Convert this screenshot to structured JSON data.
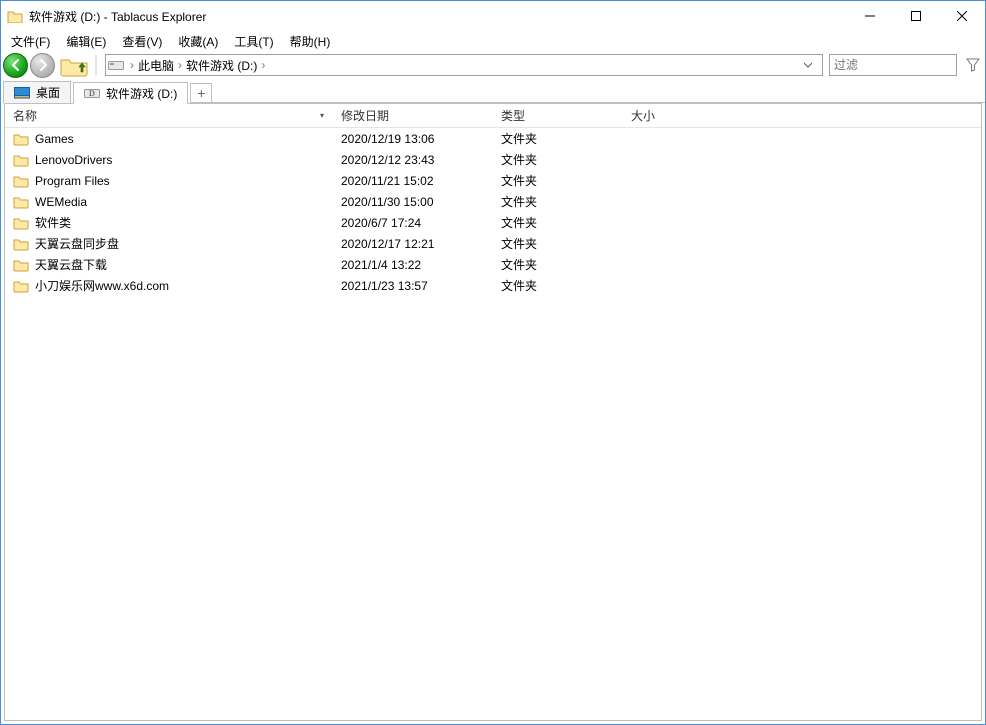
{
  "window_title": "软件游戏 (D:) - Tablacus Explorer",
  "menu": [
    "文件(F)",
    "编辑(E)",
    "查看(V)",
    "收藏(A)",
    "工具(T)",
    "帮助(H)"
  ],
  "breadcrumbs": [
    "此电脑",
    "软件游戏 (D:)"
  ],
  "filter_placeholder": "过滤",
  "tabs": [
    {
      "label": "桌面",
      "icon": "desktop",
      "active": false
    },
    {
      "label": "软件游戏 (D:)",
      "icon": "drive",
      "active": true
    }
  ],
  "columns": {
    "name": "名称",
    "date": "修改日期",
    "type": "类型",
    "size": "大小"
  },
  "rows": [
    {
      "name": "Games",
      "date": "2020/12/19 13:06",
      "type": "文件夹",
      "size": ""
    },
    {
      "name": "LenovoDrivers",
      "date": "2020/12/12 23:43",
      "type": "文件夹",
      "size": ""
    },
    {
      "name": "Program Files",
      "date": "2020/11/21 15:02",
      "type": "文件夹",
      "size": ""
    },
    {
      "name": "WEMedia",
      "date": "2020/11/30 15:00",
      "type": "文件夹",
      "size": ""
    },
    {
      "name": "软件类",
      "date": "2020/6/7 17:24",
      "type": "文件夹",
      "size": ""
    },
    {
      "name": "天翼云盘同步盘",
      "date": "2020/12/17 12:21",
      "type": "文件夹",
      "size": ""
    },
    {
      "name": "天翼云盘下载",
      "date": "2021/1/4 13:22",
      "type": "文件夹",
      "size": ""
    },
    {
      "name": "小刀娱乐网www.x6d.com",
      "date": "2021/1/23 13:57",
      "type": "文件夹",
      "size": ""
    }
  ]
}
